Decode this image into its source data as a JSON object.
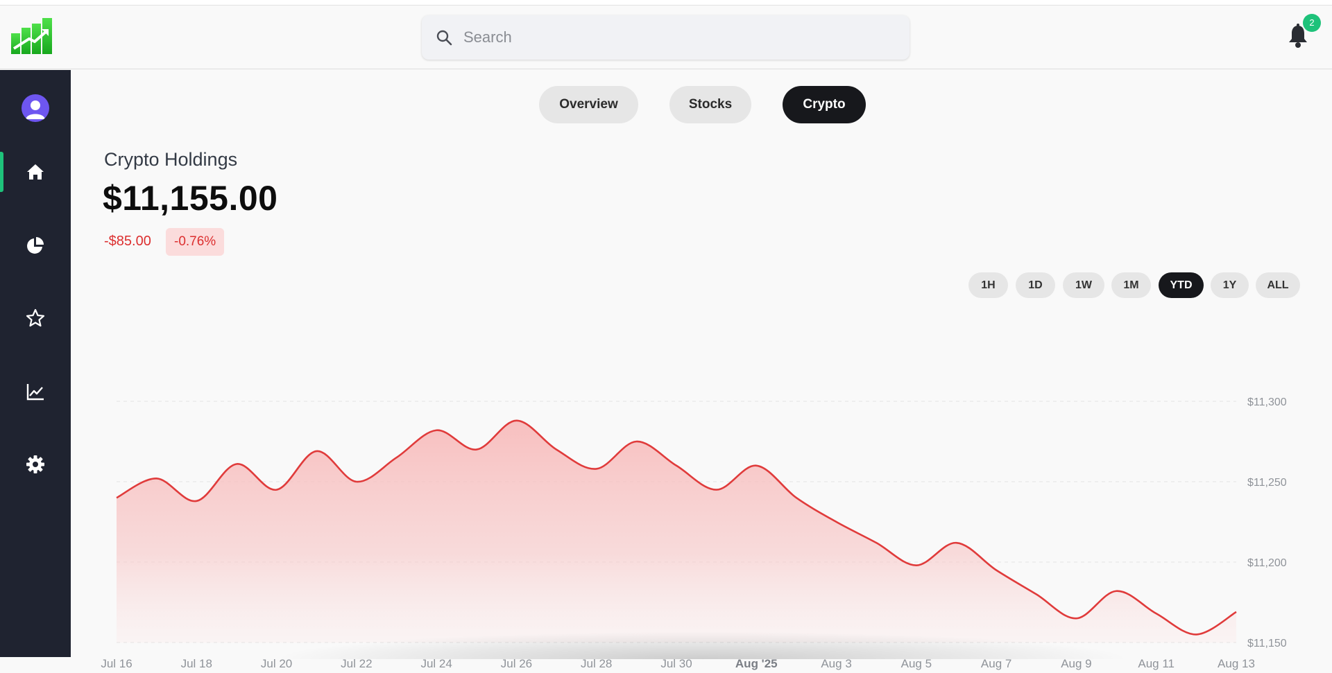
{
  "header": {
    "search_placeholder": "Search",
    "notification_count": "2"
  },
  "tabs": [
    {
      "label": "Overview",
      "active": false
    },
    {
      "label": "Stocks",
      "active": false
    },
    {
      "label": "Crypto",
      "active": true
    }
  ],
  "holdings": {
    "title": "Crypto Holdings",
    "value": "$11,155.00",
    "change_abs": "-$85.00",
    "change_pct": "-0.76%"
  },
  "ranges": [
    {
      "label": "1H",
      "active": false
    },
    {
      "label": "1D",
      "active": false
    },
    {
      "label": "1W",
      "active": false
    },
    {
      "label": "1M",
      "active": false
    },
    {
      "label": "YTD",
      "active": true
    },
    {
      "label": "1Y",
      "active": false
    },
    {
      "label": "ALL",
      "active": false
    }
  ],
  "colors": {
    "accent_green": "#1ec27a",
    "negative_red": "#dc2f2f",
    "sidebar_bg": "#1f2330",
    "line_red": "#e03b3b"
  },
  "sidebar_icons": [
    "user-avatar-icon",
    "home-icon",
    "pie-chart-icon",
    "star-icon",
    "line-chart-icon",
    "gear-icon"
  ],
  "chart_data": {
    "type": "area",
    "title": "",
    "xlabel": "",
    "ylabel": "",
    "ylim": [
      11150,
      11300
    ],
    "y_ticks": [
      "$11,300",
      "$11,250",
      "$11,200",
      "$11,150"
    ],
    "y_tick_values": [
      11300,
      11250,
      11200,
      11150
    ],
    "x_tick_labels": [
      "Jul 16",
      "Jul 18",
      "Jul 20",
      "Jul 22",
      "Jul 24",
      "Jul 26",
      "Jul 28",
      "Jul 30",
      "Aug '25",
      "Aug 3",
      "Aug 5",
      "Aug 7",
      "Aug 9",
      "Aug 11",
      "Aug 13"
    ],
    "x_tick_bold": "Aug '25",
    "x_start": "2025-07-16",
    "x_end": "2025-08-13",
    "grid": true,
    "series": [
      {
        "x": [
          "2025-07-16",
          "2025-07-17",
          "2025-07-18",
          "2025-07-19",
          "2025-07-20",
          "2025-07-21",
          "2025-07-22",
          "2025-07-23",
          "2025-07-24",
          "2025-07-25",
          "2025-07-26",
          "2025-07-27",
          "2025-07-28",
          "2025-07-29",
          "2025-07-30",
          "2025-07-31",
          "2025-08-01",
          "2025-08-02",
          "2025-08-03",
          "2025-08-04",
          "2025-08-05",
          "2025-08-06",
          "2025-08-07",
          "2025-08-08",
          "2025-08-09",
          "2025-08-10",
          "2025-08-11",
          "2025-08-12",
          "2025-08-13"
        ],
        "values": [
          11240,
          11252,
          11238,
          11261,
          11245,
          11269,
          11250,
          11265,
          11282,
          11270,
          11288,
          11270,
          11258,
          11275,
          11260,
          11245,
          11260,
          11240,
          11225,
          11212,
          11198,
          11212,
          11195,
          11180,
          11165,
          11182,
          11168,
          11155,
          11169
        ]
      }
    ]
  }
}
